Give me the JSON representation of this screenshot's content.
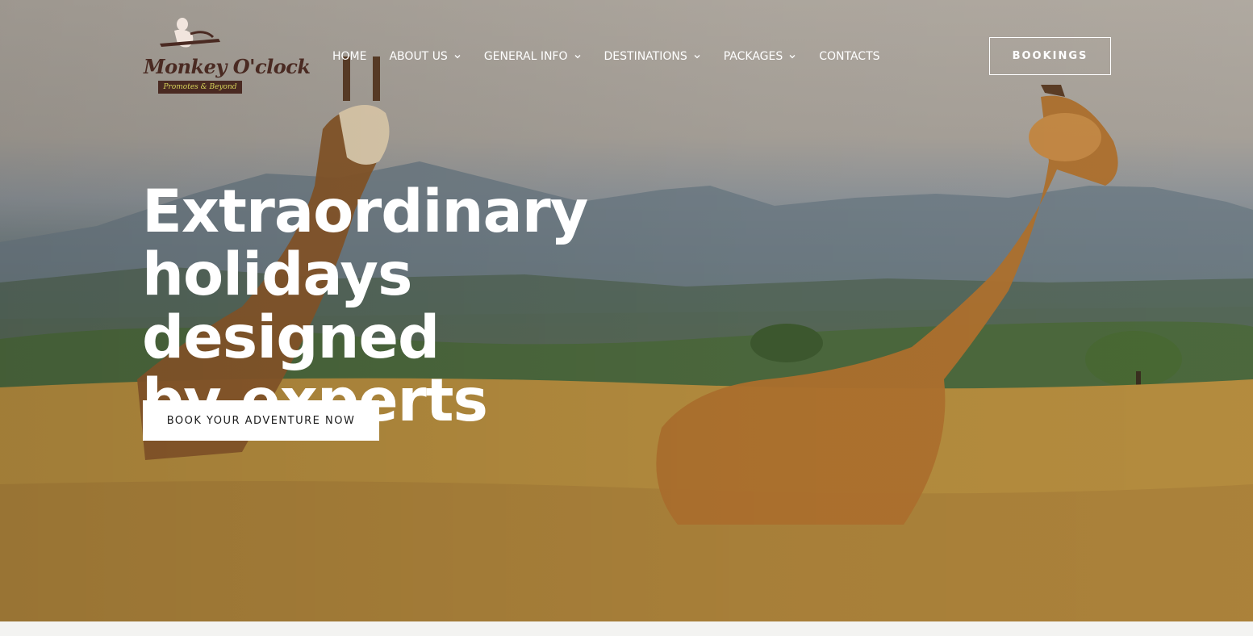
{
  "brand": {
    "name": "Monkey O'clock",
    "tagline": "Promotes & Beyond"
  },
  "nav": {
    "items": [
      {
        "label": "HOME",
        "has_dropdown": false,
        "active": true
      },
      {
        "label": "ABOUT US",
        "has_dropdown": true
      },
      {
        "label": "GENERAL INFO",
        "has_dropdown": true
      },
      {
        "label": "DESTINATIONS",
        "has_dropdown": true
      },
      {
        "label": "PACKAGES",
        "has_dropdown": true
      },
      {
        "label": "CONTACTS",
        "has_dropdown": false
      }
    ],
    "bookings_label": "BOOKINGS"
  },
  "hero": {
    "headline_lines": [
      "Extraordinary",
      "holidays designed",
      "by experts"
    ],
    "cta_label": "BOOK YOUR ADVENTURE NOW",
    "background_image": "giraffes-savanna-photo"
  },
  "colors": {
    "text_light": "#ffffff",
    "brand_brown": "#4a2a22",
    "brand_yellow": "#d7d45a",
    "cta_bg": "#ffffff",
    "cta_text": "#1c1c1c"
  }
}
